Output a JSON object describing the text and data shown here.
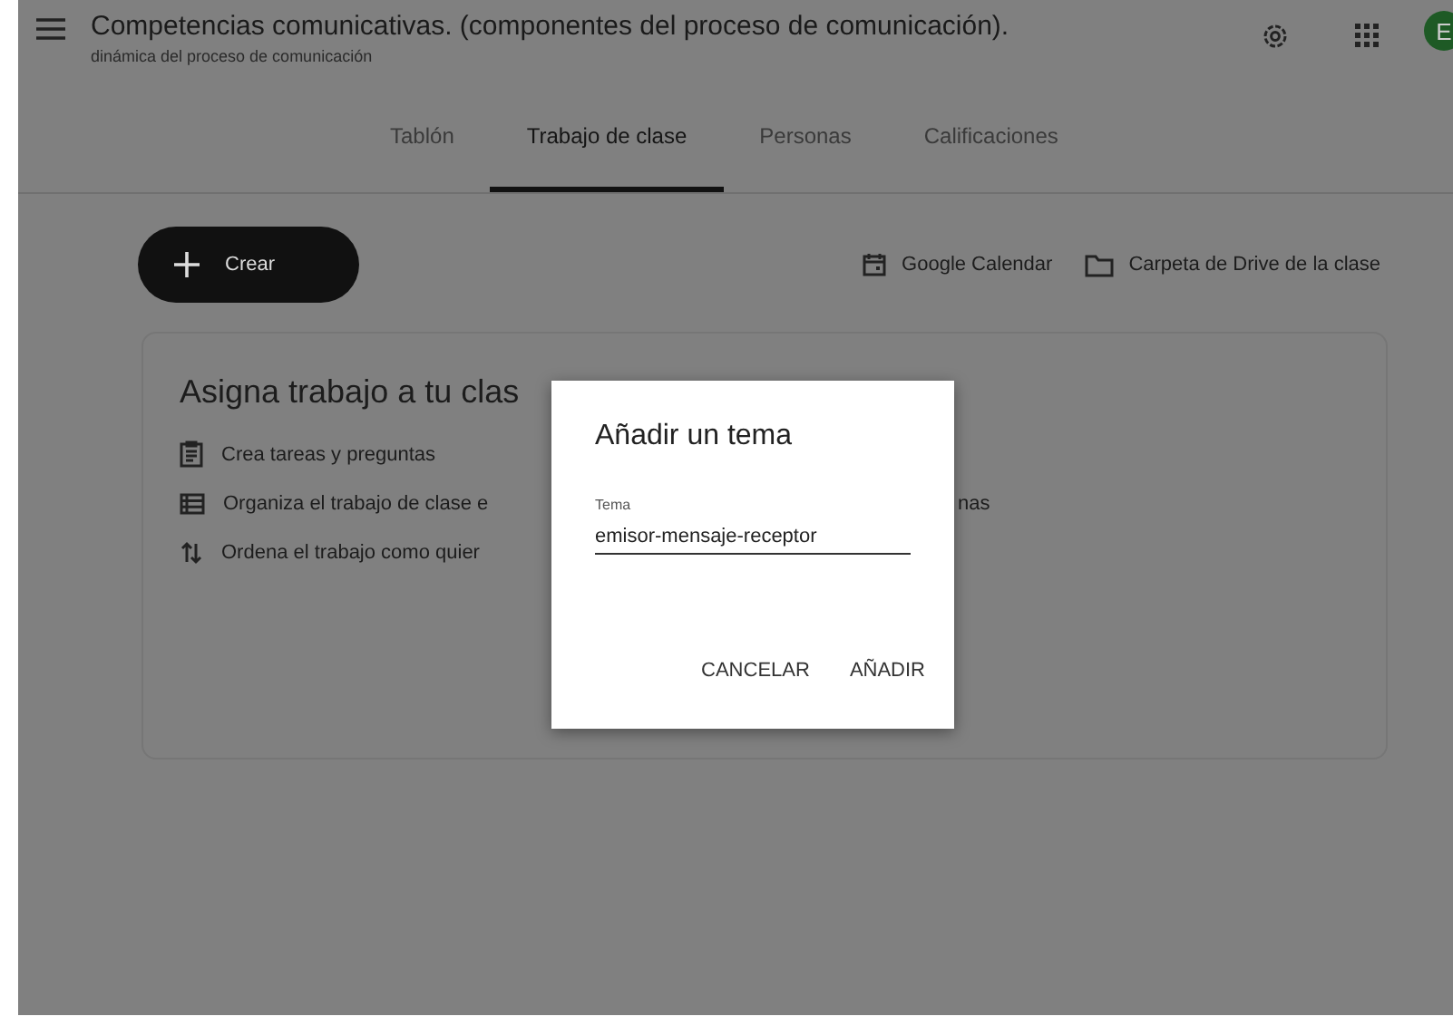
{
  "header": {
    "title": "Competencias comunicativas. (componentes del proceso de comunicación).",
    "subtitle": "dinámica del proceso de comunicación",
    "avatar": "E"
  },
  "tabs": [
    {
      "label": "Tablón",
      "selected": false
    },
    {
      "label": "Trabajo de clase",
      "selected": true
    },
    {
      "label": "Personas",
      "selected": false
    },
    {
      "label": "Calificaciones",
      "selected": false
    }
  ],
  "create_button": "Crear",
  "links": [
    {
      "kind": "calendar",
      "label": "Google Calendar"
    },
    {
      "kind": "folder",
      "label": "Carpeta de Drive de la clase"
    }
  ],
  "card": {
    "heading": "Asigna trabajo a tu clas",
    "items": [
      {
        "kind": "clipboard",
        "text": "Crea tareas y preguntas"
      },
      {
        "kind": "list",
        "text": "Organiza el trabajo de clase e",
        "tail": "nas"
      },
      {
        "kind": "sort",
        "text": "Ordena el trabajo como quier"
      }
    ]
  },
  "dialog": {
    "title": "Añadir un tema",
    "field_label": "Tema",
    "value": "emisor-mensaje-receptor",
    "buttons": [
      "CANCELAR",
      "AÑADIR"
    ]
  }
}
